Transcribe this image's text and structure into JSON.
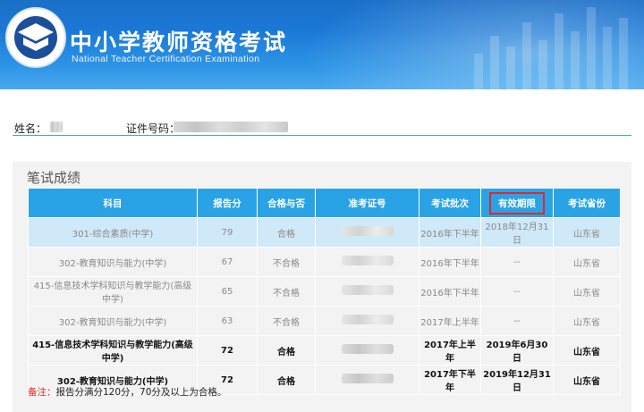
{
  "header": {
    "title_cn": "中小学教师资格考试",
    "title_en": "National Teacher Certification Examination"
  },
  "person": {
    "name_label": "姓名：",
    "id_label": "证件号码："
  },
  "scores": {
    "section_title": "笔试成绩",
    "columns": [
      "科目",
      "报告分",
      "合格与否",
      "准考证号",
      "考试批次",
      "有效期限",
      "考试省份"
    ],
    "rows": [
      {
        "subject": "301-综合素质(中学)",
        "score": "79",
        "pass": "合格",
        "batch": "2016年下半年",
        "valid": "2018年12月31日",
        "province": "山东省"
      },
      {
        "subject": "302-教育知识与能力(中学)",
        "score": "67",
        "pass": "不合格",
        "batch": "2016年下半年",
        "valid": "--",
        "province": "山东省"
      },
      {
        "subject": "415-信息技术学科知识与教学能力(高级中学)",
        "score": "65",
        "pass": "不合格",
        "batch": "2016年下半年",
        "valid": "--",
        "province": "山东省"
      },
      {
        "subject": "302-教育知识与能力(中学)",
        "score": "63",
        "pass": "不合格",
        "batch": "2017年上半年",
        "valid": "--",
        "province": "山东省"
      },
      {
        "subject": "415-信息技术学科知识与教学能力(高级中学)",
        "score": "72",
        "pass": "合格",
        "batch": "2017年上半年",
        "valid": "2019年6月30日",
        "province": "山东省"
      },
      {
        "subject": "302-教育知识与能力(中学)",
        "score": "72",
        "pass": "合格",
        "batch": "2017年下半年",
        "valid": "2019年12月31日",
        "province": "山东省"
      }
    ]
  },
  "note": {
    "label": "备注：",
    "text": "报告分满分120分，70分及以上为合格。"
  },
  "colors": {
    "header_blue": "#1a79d6",
    "table_header": "#29a3e5",
    "highlight_row": "#cfe9f8",
    "annotation_red": "#e0282e"
  }
}
